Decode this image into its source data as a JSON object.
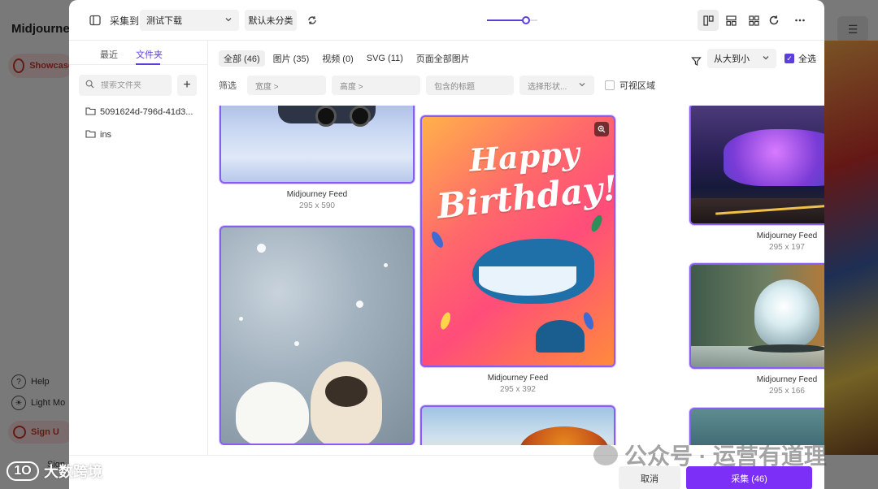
{
  "background": {
    "app_title": "Midjourney",
    "nav_showcase": "Showcase",
    "help": "Help",
    "light_mode": "Light Mo",
    "sign_up": "Sign U",
    "sign_in": "Sign"
  },
  "toolbar": {
    "collect_to_label": "采集到",
    "folder_select": "测试下载",
    "default_uncategorized": "默认未分类",
    "zoom_level": 0.78
  },
  "left_panel": {
    "tabs": [
      "最近",
      "文件夹"
    ],
    "active_tab": "文件夹",
    "search_placeholder": "搜索文件夹",
    "folders": [
      "5091624d-796d-41d3...",
      "ins"
    ]
  },
  "filters": {
    "type_tabs": [
      {
        "label": "全部 (46)",
        "active": true
      },
      {
        "label": "图片 (35)",
        "active": false
      },
      {
        "label": "视频 (0)",
        "active": false
      },
      {
        "label": "SVG (11)",
        "active": false
      },
      {
        "label": "页面全部图片",
        "active": false
      }
    ],
    "sort": "从大到小",
    "select_all": "全选",
    "select_all_checked": true,
    "filter_label": "筛选",
    "width_placeholder": "宽度 >",
    "height_placeholder": "高度 >",
    "title_placeholder": "包含的标题",
    "shape_placeholder": "选择形状...",
    "visible_area": "可视区域",
    "visible_area_checked": false
  },
  "gallery": {
    "items": [
      {
        "caption": "Midjourney Feed",
        "dimensions": "295 x 590"
      },
      {
        "caption": "Midjourney Feed",
        "dimensions": "295 x 392",
        "image_text_1": "Happy",
        "image_text_2": "Birthday!"
      },
      {
        "caption": "Midjourney Feed",
        "dimensions": "295 x 197"
      },
      {
        "caption": "Midjourney Feed",
        "dimensions": "295 x 166"
      }
    ]
  },
  "footer": {
    "cancel": "取消",
    "collect": "采集 (46)"
  },
  "watermarks": {
    "left": "大数跨境",
    "right": "公众号 · 运营有道理"
  },
  "colors": {
    "accent": "#5b3fd6",
    "primary_button": "#7b2ff7",
    "selection_border": "#8a5cf6"
  }
}
